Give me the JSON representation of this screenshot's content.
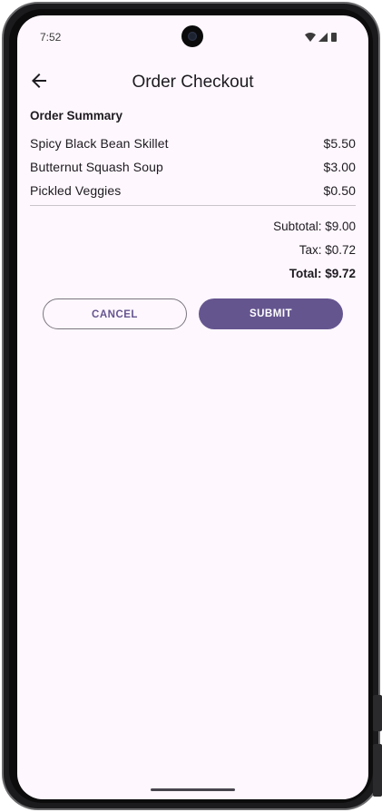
{
  "status_bar": {
    "time": "7:52"
  },
  "app_bar": {
    "back_icon": "arrow-left-icon",
    "title": "Order Checkout"
  },
  "order_summary": {
    "heading": "Order Summary",
    "items": [
      {
        "name": "Spicy Black Bean Skillet",
        "price": "$5.50"
      },
      {
        "name": "Butternut Squash Soup",
        "price": "$3.00"
      },
      {
        "name": "Pickled Veggies",
        "price": "$0.50"
      }
    ],
    "subtotal": "Subtotal: $9.00",
    "tax": "Tax: $0.72",
    "total": "Total: $9.72"
  },
  "actions": {
    "cancel_label": "CANCEL",
    "submit_label": "SUBMIT"
  },
  "colors": {
    "primary": "#65558f",
    "background": "#fef7fe",
    "on_surface": "#1d1b20",
    "outline": "#7a757f"
  }
}
